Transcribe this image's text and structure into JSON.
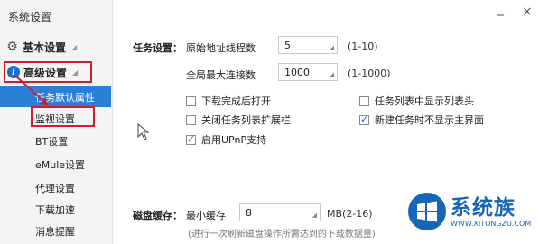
{
  "window": {
    "title": "系统设置",
    "minimize": "_",
    "close": "×"
  },
  "sidebar": {
    "basic": {
      "label": "基本设置",
      "icon": "gear-icon"
    },
    "advanced": {
      "label": "高级设置",
      "icon": "info-icon",
      "icon_glyph": "i"
    },
    "items": [
      {
        "label": "任务默认属性",
        "selected": true
      },
      {
        "label": "监视设置",
        "selected": false
      },
      {
        "label": "BT设置",
        "selected": false
      },
      {
        "label": "eMule设置",
        "selected": false
      },
      {
        "label": "代理设置",
        "selected": false
      },
      {
        "label": "下载加速",
        "selected": false
      },
      {
        "label": "消息提醒",
        "selected": false
      }
    ]
  },
  "task_settings": {
    "section_label": "任务设置：",
    "threads_label": "原始地址线程数",
    "threads_value": "5",
    "threads_range": "(1-10)",
    "max_conn_label": "全局最大连接数",
    "max_conn_value": "1000",
    "max_conn_range": "(1-1000)",
    "checkboxes": [
      {
        "label": "下载完成后打开",
        "checked": false
      },
      {
        "label": "任务列表中显示列表头",
        "checked": false
      },
      {
        "label": "关闭任务列表扩展栏",
        "checked": false
      },
      {
        "label": "新建任务时不显示主界面",
        "checked": true
      },
      {
        "label": "启用UPnP支持",
        "checked": true
      }
    ]
  },
  "disk_cache": {
    "section_label": "磁盘缓存：",
    "min_label": "最小缓存",
    "min_value": "8",
    "unit_range": "MB(2-16)",
    "hint": "(进行一次刷新磁盘操作所需达到的下载数据量)"
  },
  "watermark": {
    "brand": "系统族",
    "url": "WWW.XITONGZU.COM"
  },
  "colors": {
    "accent": "#2b7fd6",
    "highlight": "#d01f2a",
    "brand": "#1565b8"
  }
}
